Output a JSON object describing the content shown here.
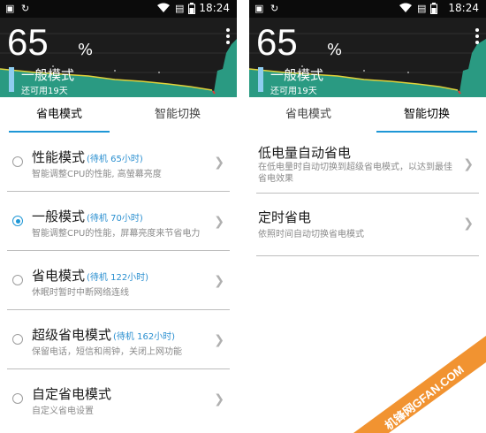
{
  "status_bar": {
    "time": "18:24"
  },
  "battery": {
    "percent": "65",
    "percent_sign": "%",
    "mode": "一般模式",
    "remaining": "还可用19天"
  },
  "colors": {
    "accent": "#1e97d6",
    "graph_fill": "#2a9a82",
    "graph_line": "#e0d23a",
    "header_bg": "#1c1c1c"
  },
  "left_panel": {
    "tabs": [
      "省电模式",
      "智能切换"
    ],
    "active_tab": 0,
    "modes": [
      {
        "title": "性能模式",
        "standby": "(待机 65小时)",
        "desc": "智能调整CPU的性能, 高螢幕亮度",
        "selected": false
      },
      {
        "title": "一般模式",
        "standby": "(待机 70小时)",
        "desc": "智能调整CPU的性能，屏幕亮度来节省电力",
        "selected": true
      },
      {
        "title": "省电模式",
        "standby": "(待机 122小时)",
        "desc": "休眠时暂时中断网络连线",
        "selected": false
      },
      {
        "title": "超级省电模式",
        "standby": "(待机 162小时)",
        "desc": "保留电话，短信和闹钟，关闭上网功能",
        "selected": false
      },
      {
        "title": "自定省电模式",
        "standby": "",
        "desc": "自定义省电设置",
        "selected": false
      }
    ]
  },
  "right_panel": {
    "tabs": [
      "省电模式",
      "智能切换"
    ],
    "active_tab": 1,
    "items": [
      {
        "title": "低电量自动省电",
        "desc": "在低电量时自动切换到超级省电模式，以达到最佳省电效果"
      },
      {
        "title": "定时省电",
        "desc": "依照时间自动切换省电模式"
      }
    ]
  },
  "watermark": {
    "text": "机锋网GFAN.COM"
  }
}
